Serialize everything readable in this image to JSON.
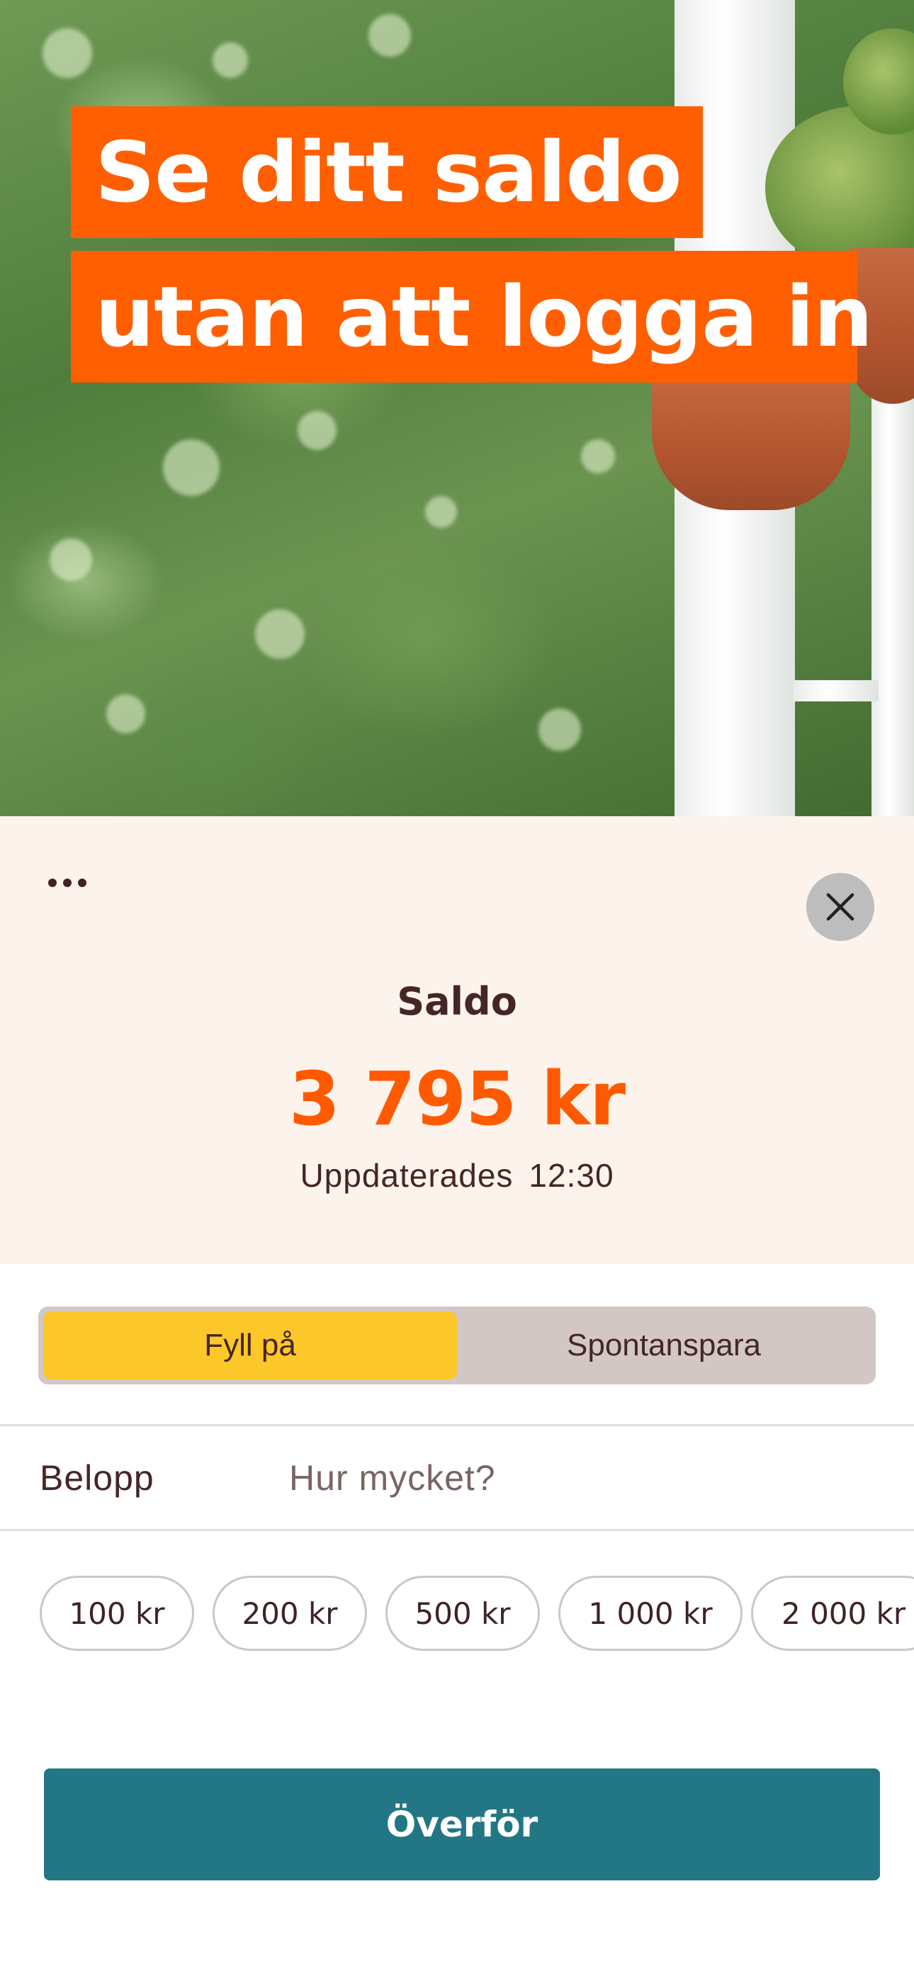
{
  "hero": {
    "headline_line1": "Se ditt saldo",
    "headline_line2": "utan att logga in",
    "accent_color": "#ff5f00"
  },
  "balance": {
    "more_icon": "ellipsis-icon",
    "close_icon": "close-icon",
    "label": "Saldo",
    "amount": "3 795 kr",
    "updated_label": "Uppdaterades",
    "updated_time": "12:30",
    "amount_color": "#ff5a00"
  },
  "tabs": [
    {
      "label": "Fyll på",
      "active": true
    },
    {
      "label": "Spontanspara",
      "active": false
    }
  ],
  "amount_field": {
    "label": "Belopp",
    "placeholder": "Hur mycket?",
    "value": ""
  },
  "quick_amounts": [
    "100 kr",
    "200 kr",
    "500 kr",
    "1 000 kr",
    "2 000 kr"
  ],
  "transfer_button": {
    "label": "Överför",
    "color": "#237785"
  }
}
